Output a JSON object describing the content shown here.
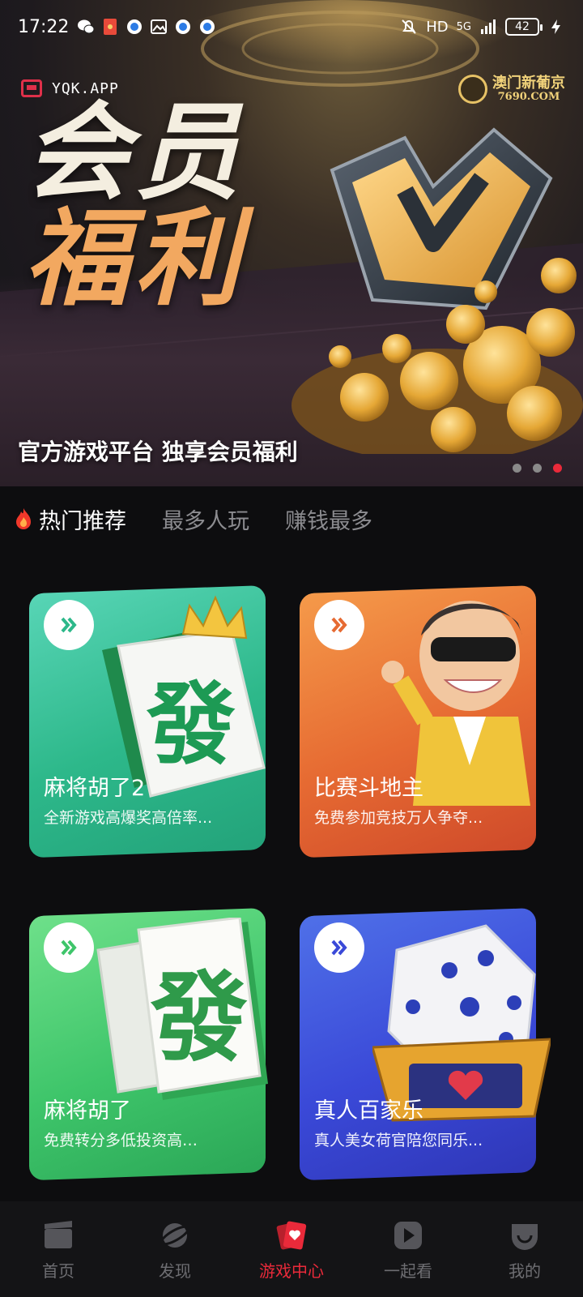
{
  "status_bar": {
    "time": "17:22",
    "network": "HD",
    "signal": "5G",
    "battery": "42"
  },
  "banner": {
    "app_tag": "YQK.APP",
    "brand_name": "澳门新葡京",
    "brand_domain": "7690.COM",
    "calligraphy_line1": "会员",
    "calligraphy_line2": "福利",
    "caption": "官方游戏平台 独享会员福利",
    "dot_count": 3,
    "active_dot": 3
  },
  "tabs": [
    {
      "label": "热门推荐",
      "active": true
    },
    {
      "label": "最多人玩",
      "active": false
    },
    {
      "label": "赚钱最多",
      "active": false
    }
  ],
  "cards": [
    {
      "title": "麻将胡了2",
      "subtitle": "全新游戏高爆奖高倍率...",
      "arrow_color": "#2db88a",
      "tile_char": "發"
    },
    {
      "title": "比赛斗地主",
      "subtitle": "免费参加竞技万人争夺...",
      "arrow_color": "#e66a32"
    },
    {
      "title": "麻将胡了",
      "subtitle": "免费转分多低投资高…",
      "arrow_color": "#3ec56a",
      "tile_char": "發"
    },
    {
      "title": "真人百家乐",
      "subtitle": "真人美女荷官陪您同乐...",
      "arrow_color": "#3a49d8"
    }
  ],
  "bottom_nav": [
    {
      "label": "首页",
      "icon": "clapperboard-icon",
      "active": false
    },
    {
      "label": "发现",
      "icon": "planet-icon",
      "active": false
    },
    {
      "label": "游戏中心",
      "icon": "card-heart-icon",
      "active": true
    },
    {
      "label": "一起看",
      "icon": "play-icon",
      "active": false
    },
    {
      "label": "我的",
      "icon": "profile-icon",
      "active": false
    }
  ],
  "colors": {
    "accent": "#ea2a3a",
    "background": "#0d0d0f",
    "nav_background": "#141416"
  }
}
